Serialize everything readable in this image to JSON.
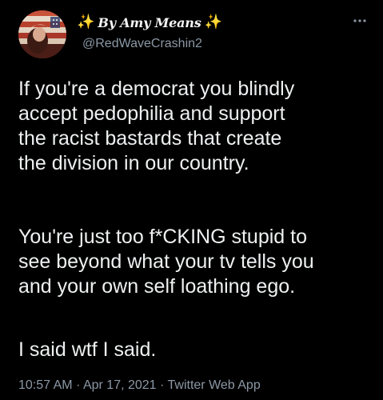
{
  "author": {
    "display_name": "By Amy Means",
    "handle": "@RedWaveCrashin2",
    "sparkle_left": "✨",
    "sparkle_right": "✨",
    "avatar_icon": "avatar-image",
    "more_icon": "more-options-icon"
  },
  "tweet": {
    "paragraph_1": [
      "If you're a democrat you blindly",
      "accept pedophilia and support",
      "the racist bastards that create",
      "the division in our country."
    ],
    "paragraph_2": [
      "You're just too f*CKING stupid to",
      "see beyond what your tv tells you",
      "and your own self loathing ego."
    ],
    "paragraph_3": [
      "I said wtf I said."
    ]
  },
  "meta": {
    "time": "10:57 AM",
    "separator": "·",
    "date": "Apr 17, 2021",
    "source": "Twitter Web App"
  },
  "colors": {
    "background": "#000000",
    "text": "#eef0f1",
    "secondary": "#8b98a5",
    "sparkle": "#ffd23f"
  }
}
